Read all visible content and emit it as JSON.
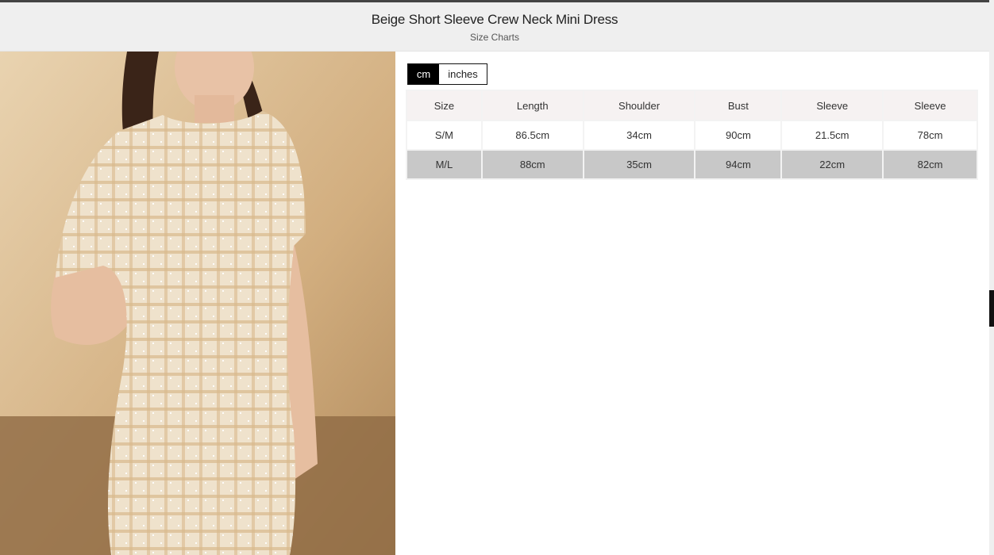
{
  "header": {
    "title": "Beige Short Sleeve Crew Neck Mini Dress",
    "subtitle": "Size Charts"
  },
  "unit_toggle": {
    "options": [
      "cm",
      "inches"
    ],
    "selected": "cm"
  },
  "size_table": {
    "columns": [
      "Size",
      "Length",
      "Shoulder",
      "Bust",
      "Sleeve",
      "Sleeve"
    ],
    "rows": [
      [
        "S/M",
        "86.5cm",
        "34cm",
        "90cm",
        "21.5cm",
        "78cm"
      ],
      [
        "M/L",
        "88cm",
        "35cm",
        "94cm",
        "22cm",
        "82cm"
      ]
    ]
  },
  "colors": {
    "header_bg": "#efefef",
    "toggle_active": "#000000",
    "row_highlight": "#c8c8c8"
  }
}
